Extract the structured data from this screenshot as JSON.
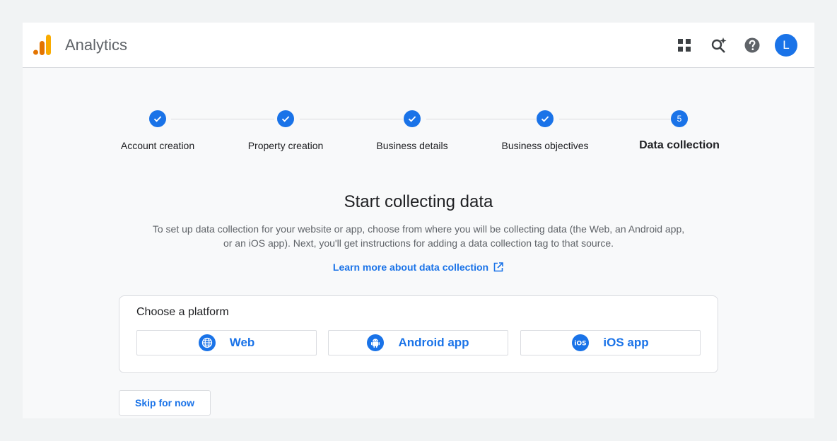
{
  "header": {
    "app_title": "Analytics",
    "avatar_letter": "L"
  },
  "stepper": {
    "steps": [
      {
        "label": "Account creation",
        "state": "complete"
      },
      {
        "label": "Property creation",
        "state": "complete"
      },
      {
        "label": "Business details",
        "state": "complete"
      },
      {
        "label": "Business objectives",
        "state": "complete"
      },
      {
        "label": "Data collection",
        "state": "active",
        "number": "5"
      }
    ]
  },
  "main": {
    "heading": "Start collecting data",
    "description": "To set up data collection for your website or app, choose from where you will be collecting data (the Web, an Android app, or an iOS app). Next, you'll get instructions for adding a data collection tag to that source.",
    "learn_more": "Learn more about data collection"
  },
  "platform": {
    "title": "Choose a platform",
    "options": [
      {
        "label": "Web",
        "icon": "globe-icon"
      },
      {
        "label": "Android app",
        "icon": "android-icon"
      },
      {
        "label": "iOS app",
        "icon": "ios-icon"
      }
    ]
  },
  "footer": {
    "skip_label": "Skip for now"
  },
  "colors": {
    "accent": "#1a73e8",
    "logo_orange": "#f9ab00",
    "logo_dark_orange": "#e37400"
  }
}
